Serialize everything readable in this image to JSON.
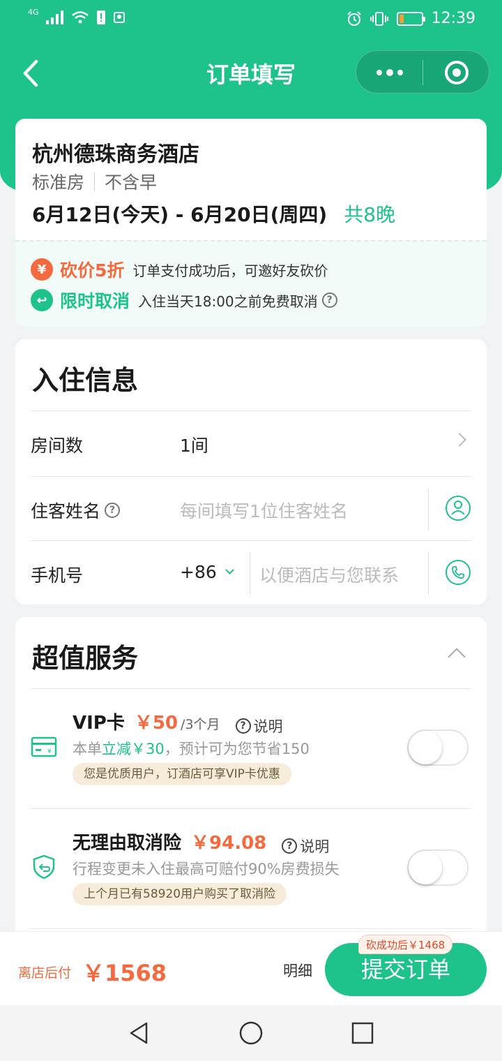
{
  "status_bar": {
    "network": "4G",
    "time": "12:39"
  },
  "nav": {
    "title": "订单填写"
  },
  "hotel": {
    "name": "杭州德珠商务酒店",
    "room_type": "标准房",
    "breakfast": "不含早",
    "dates": "6月12日(今天) - 6月20日(周四)",
    "nights": "共8晚"
  },
  "promos": [
    {
      "icon": "¥",
      "title": "砍价5折",
      "desc": "订单支付成功后，可邀好友砍价"
    },
    {
      "icon": "↩",
      "title": "限时取消",
      "desc": "入住当天18:00之前免费取消"
    }
  ],
  "checkin": {
    "title": "入住信息",
    "rooms_label": "房间数",
    "rooms_value": "1间",
    "guest_label": "住客姓名",
    "guest_placeholder": "每间填写1位住客姓名",
    "phone_label": "手机号",
    "phone_code": "+86",
    "phone_placeholder": "以便酒店与您联系"
  },
  "services": {
    "title": "超值服务",
    "items": [
      {
        "name": "VIP卡",
        "price": "￥50",
        "unit": "/3个月",
        "explain": "说明",
        "desc_pre": "本单",
        "desc_hl": "立减￥30",
        "desc_post": "，预计可为您节省150",
        "tag": "您是优质用户，订酒店可享VIP卡优惠"
      },
      {
        "name": "无理由取消险",
        "price": "￥94.08",
        "unit": "",
        "explain": "说明",
        "desc": "行程变更未入住最高可赔付90%房费损失",
        "tag": "上个月已有58920用户购买了取消险"
      }
    ]
  },
  "bottom": {
    "pay_label": "离店后付",
    "total": "￥1568",
    "detail": "明细",
    "submit": "提交订单",
    "badge": "砍成功后￥1468"
  },
  "colors": {
    "primary": "#1ec38b",
    "accent": "#f26a3e"
  }
}
